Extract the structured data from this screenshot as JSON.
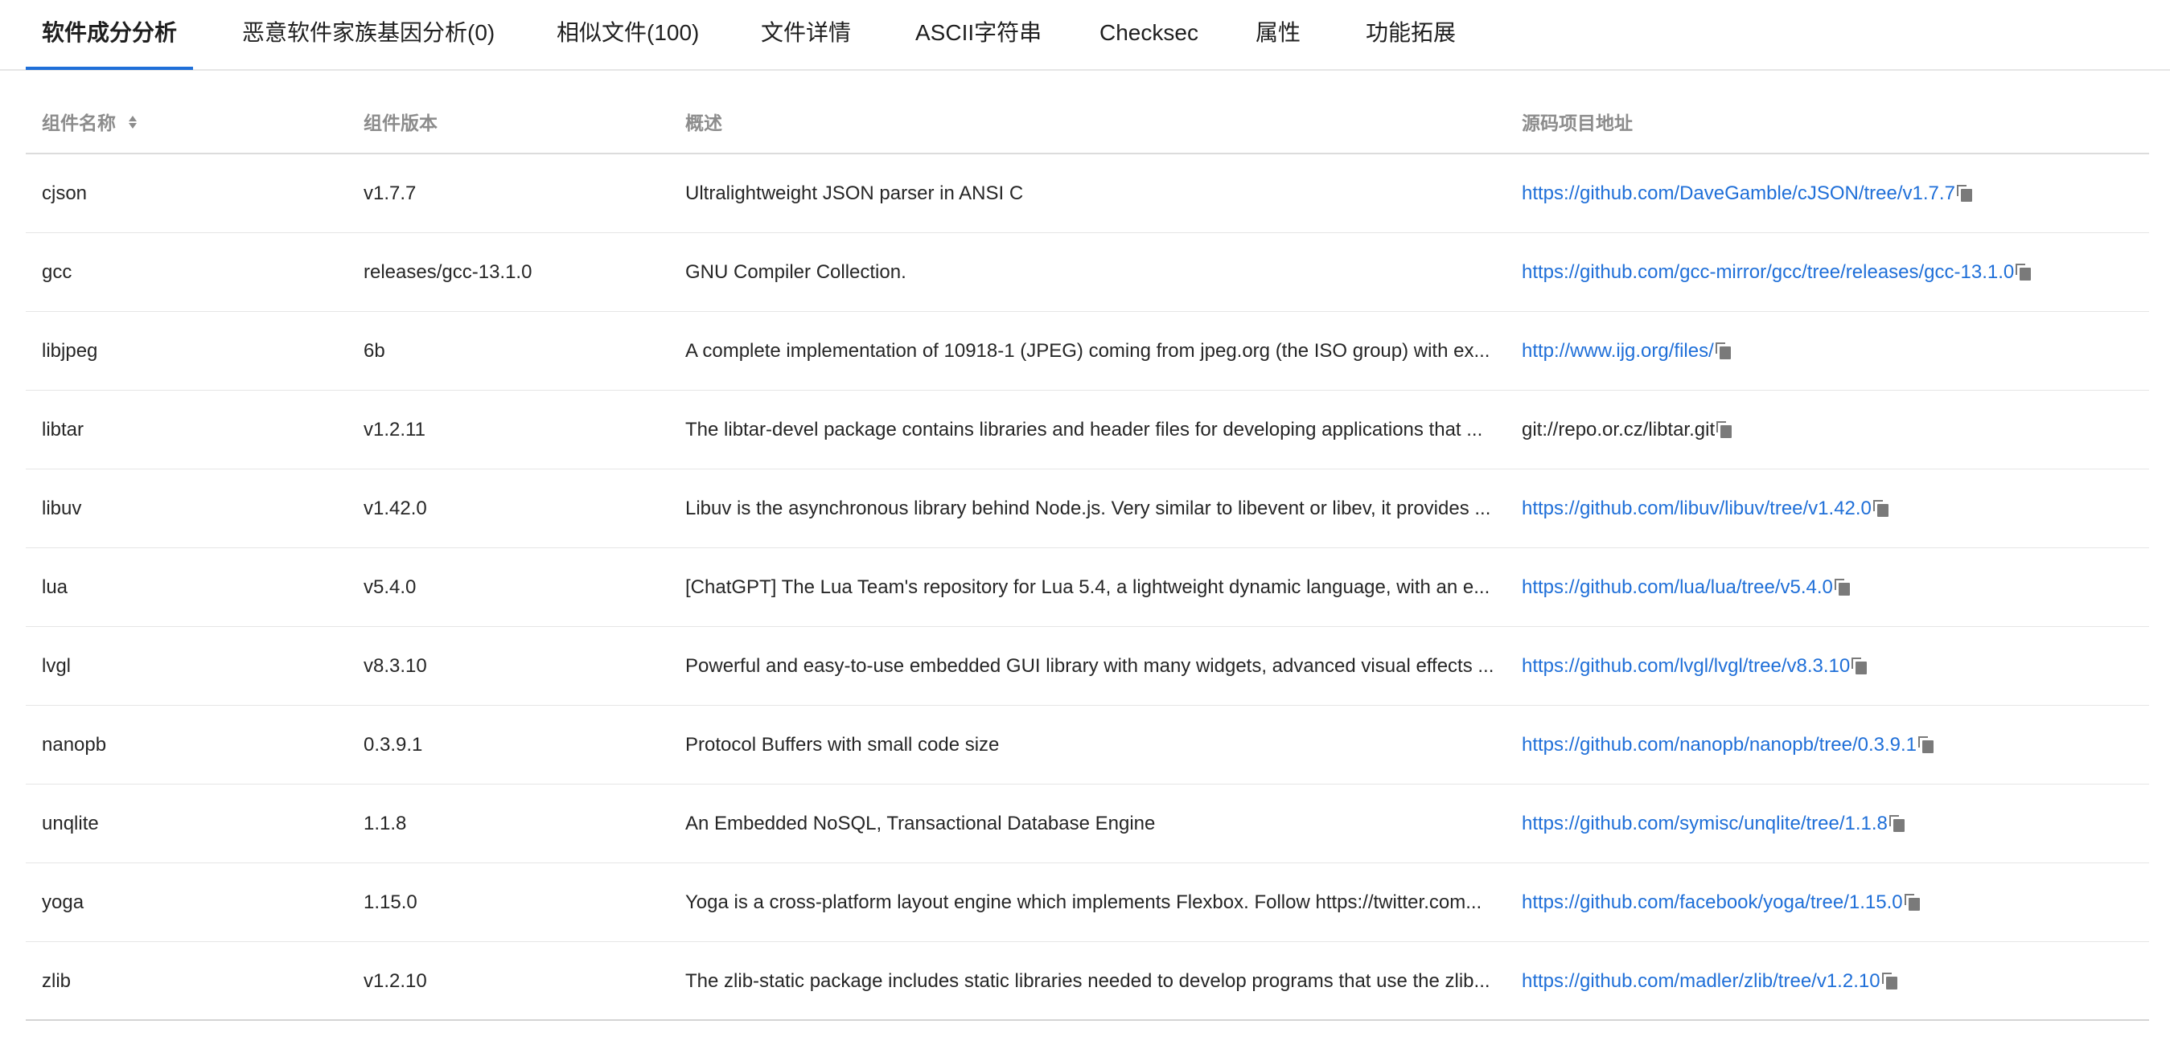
{
  "tabs": [
    {
      "label": "软件成分分析",
      "active": true
    },
    {
      "label": "恶意软件家族基因分析(0)"
    },
    {
      "label": "相似文件(100)"
    },
    {
      "label": "文件详情"
    },
    {
      "label": "ASCII字符串"
    },
    {
      "label": "Checksec"
    },
    {
      "label": "属性"
    },
    {
      "label": "功能拓展"
    }
  ],
  "table": {
    "headers": {
      "name": "组件名称",
      "version": "组件版本",
      "summary": "概述",
      "source": "源码项目地址"
    },
    "sort_icon": "sort-icon",
    "copy_icon": "copy-icon",
    "rows": [
      {
        "name": "cjson",
        "version": "v1.7.7",
        "summary": "Ultralightweight JSON parser in ANSI C",
        "source": "https://github.com/DaveGamble/cJSON/tree/v1.7.7",
        "is_link": true
      },
      {
        "name": "gcc",
        "version": "releases/gcc-13.1.0",
        "summary": "GNU Compiler Collection.",
        "source": "https://github.com/gcc-mirror/gcc/tree/releases/gcc-13.1.0",
        "is_link": true
      },
      {
        "name": "libjpeg",
        "version": "6b",
        "summary": "A complete implementation of 10918-1 (JPEG) coming from jpeg.org (the ISO group) with ex...",
        "source": "http://www.ijg.org/files/",
        "is_link": true
      },
      {
        "name": "libtar",
        "version": "v1.2.11",
        "summary": "The libtar-devel package contains libraries and header files for developing applications that ...",
        "source": "git://repo.or.cz/libtar.git",
        "is_link": false
      },
      {
        "name": "libuv",
        "version": "v1.42.0",
        "summary": "Libuv is the asynchronous library behind Node.js. Very similar to libevent or libev, it provides ...",
        "source": "https://github.com/libuv/libuv/tree/v1.42.0",
        "is_link": true
      },
      {
        "name": "lua",
        "version": "v5.4.0",
        "summary": "[ChatGPT] The Lua Team's repository for Lua 5.4, a lightweight dynamic language, with an e...",
        "source": "https://github.com/lua/lua/tree/v5.4.0",
        "is_link": true
      },
      {
        "name": "lvgl",
        "version": "v8.3.10",
        "summary": "Powerful and easy-to-use embedded GUI library with many widgets, advanced visual effects ...",
        "source": "https://github.com/lvgl/lvgl/tree/v8.3.10",
        "is_link": true
      },
      {
        "name": "nanopb",
        "version": "0.3.9.1",
        "summary": "Protocol Buffers with small code size",
        "source": "https://github.com/nanopb/nanopb/tree/0.3.9.1",
        "is_link": true
      },
      {
        "name": "unqlite",
        "version": "1.1.8",
        "summary": "An Embedded NoSQL, Transactional Database Engine",
        "source": "https://github.com/symisc/unqlite/tree/1.1.8",
        "is_link": true
      },
      {
        "name": "yoga",
        "version": "1.15.0",
        "summary": "Yoga is a cross-platform layout engine which implements Flexbox. Follow https://twitter.com...",
        "source": "https://github.com/facebook/yoga/tree/1.15.0",
        "is_link": true
      },
      {
        "name": "zlib",
        "version": "v1.2.10",
        "summary": "The zlib-static package includes static libraries needed to develop programs that use the zlib...",
        "source": "https://github.com/madler/zlib/tree/v1.2.10",
        "is_link": true
      }
    ]
  },
  "colors": {
    "accent": "#1f6fd8",
    "header_text": "#8c8c8c",
    "body_text": "#262626",
    "divider": "#e6e6e6"
  }
}
